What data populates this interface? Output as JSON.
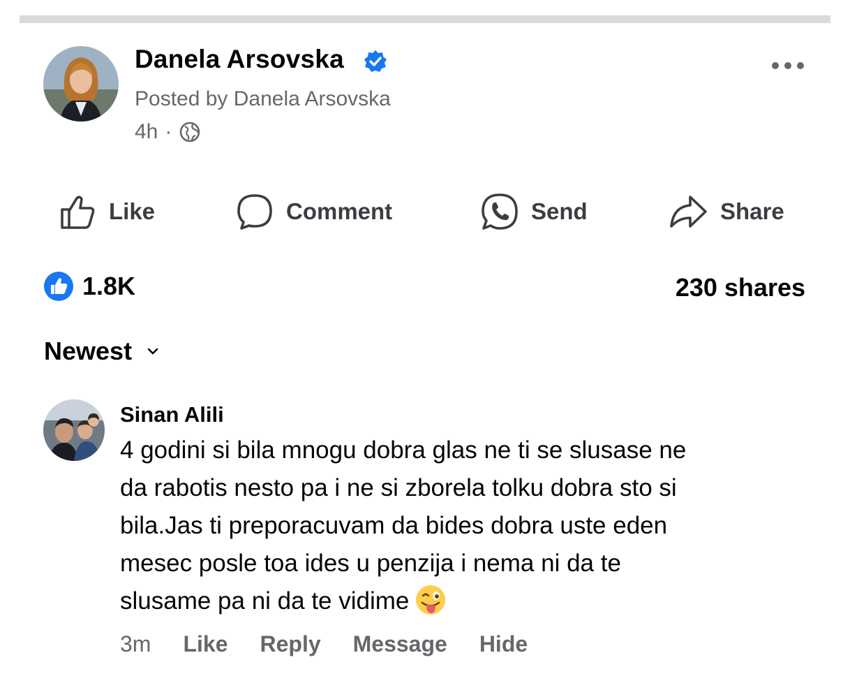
{
  "post": {
    "author": "Danela Arsovska",
    "posted_by": "Posted by Danela Arsovska",
    "time": "4h",
    "separator": "·",
    "privacy_icon": "globe-icon",
    "verified_color": "#1877f2"
  },
  "actions": {
    "like_label": "Like",
    "comment_label": "Comment",
    "send_label": "Send",
    "share_label": "Share"
  },
  "stats": {
    "reactions_count": "1.8K",
    "shares": "230 shares",
    "reaction_icon": "like-reaction-icon"
  },
  "comments_sort": {
    "label": "Newest"
  },
  "comment": {
    "author": "Sinan Alili",
    "text": "4 godini si bila mnogu dobra glas ne ti se slusase ne\nda rabotis nesto pa i ne si zborela tolku dobra sto si\nbila.Jas ti preporacuvam  da bides dobra uste eden\nmesec posle toa ides u penzija i nema ni da te\nslusame pa ni da te vidime",
    "emoji_icon": "winking-tongue-emoji",
    "time": "3m",
    "like_label": "Like",
    "reply_label": "Reply",
    "message_label": "Message",
    "hide_label": "Hide"
  },
  "colors": {
    "accent": "#1877f2",
    "secondary_text": "#65676b",
    "divider": "#d9dadc"
  }
}
